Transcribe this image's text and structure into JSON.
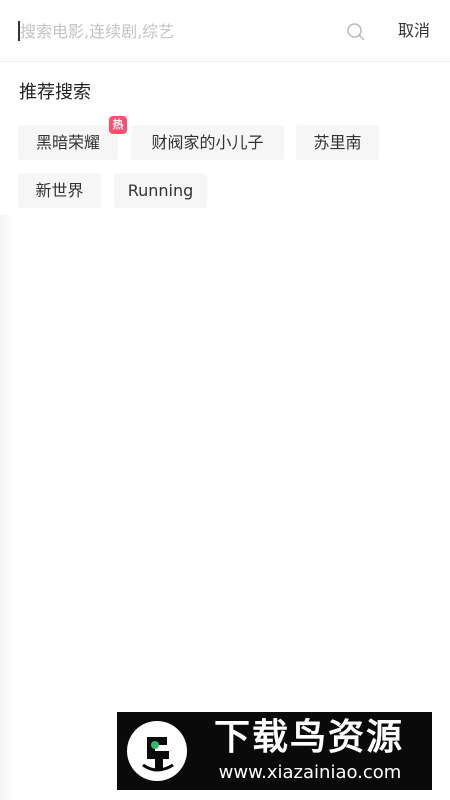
{
  "search": {
    "placeholder": "搜索电影,连续剧,综艺",
    "value": "",
    "icon": "search-icon",
    "cancel_label": "取消"
  },
  "recommend": {
    "title": "推荐搜索",
    "tags": [
      {
        "label": "黑暗荣耀",
        "hot": true,
        "hot_label": "热"
      },
      {
        "label": "财阀家的小儿子",
        "hot": false
      },
      {
        "label": "苏里南",
        "hot": false
      },
      {
        "label": "新世界",
        "hot": false
      },
      {
        "label": "Running",
        "hot": false
      }
    ]
  },
  "watermark": {
    "title": "下载鸟资源",
    "url": "www.xiazainiao.com"
  },
  "colors": {
    "hot_badge": "#ff4d6d",
    "chip_bg": "#f6f6f6",
    "watermark_bg": "#0a0a0a",
    "logo_accent": "#2bbf6a"
  }
}
